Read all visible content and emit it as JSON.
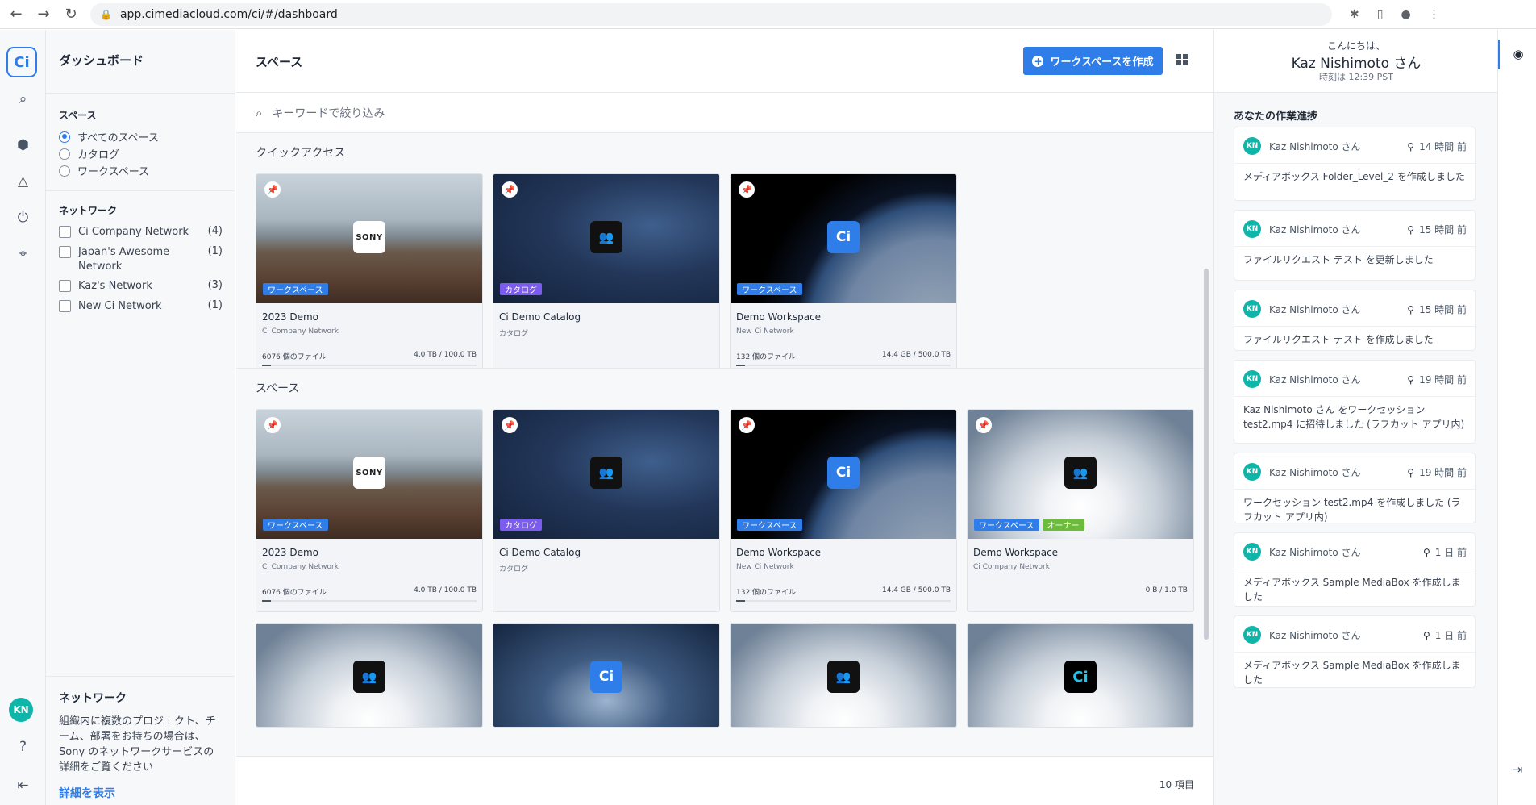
{
  "browser": {
    "url": "app.cimediacloud.com/ci/#/dashboard",
    "back": "←",
    "forward": "→",
    "reload": "↻"
  },
  "rail": {
    "logo": "Ci",
    "avatar": "KN",
    "icons": [
      "search-icon",
      "box-icon",
      "cloud-icon",
      "power-icon",
      "settings-icon",
      "help-icon",
      "logout-icon"
    ]
  },
  "sidebar": {
    "title": "ダッシュボード",
    "spaces_heading": "スペース",
    "space_filters": [
      {
        "label": "すべてのスペース",
        "selected": true
      },
      {
        "label": "カタログ",
        "selected": false
      },
      {
        "label": "ワークスペース",
        "selected": false
      }
    ],
    "network_heading": "ネットワーク",
    "networks": [
      {
        "label": "Ci Company Network",
        "count": "(4)"
      },
      {
        "label": "Japan's Awesome Network",
        "count": "(1)"
      },
      {
        "label": "Kaz's Network",
        "count": "(3)"
      },
      {
        "label": "New Ci Network",
        "count": "(1)"
      }
    ],
    "promo": {
      "title": "ネットワーク",
      "text": "組織内に複数のプロジェクト、チーム、部署をお持ちの場合は、Sony のネットワークサービスの詳細をご覧ください",
      "link": "詳細を表示"
    }
  },
  "main": {
    "title": "スペース",
    "create_button": "ワークスペースを作成",
    "search_placeholder": "キーワードで絞り込み",
    "quick_access_title": "クイックアクセス",
    "spaces_title": "スペース",
    "item_count": "10 項目",
    "quick_access": [
      {
        "name": "2023 Demo",
        "network": "Ci Company Network",
        "files": "6076 個のファイル",
        "size": "4.0 TB / 100.0 TB",
        "usage": 0.04,
        "tags": [
          "ワークスペース"
        ],
        "thumb": "beach",
        "icon": "sony-logo",
        "icon_text": "SONY"
      },
      {
        "name": "Ci Demo Catalog",
        "network": "カタログ",
        "files": "",
        "size": "",
        "tags": [
          "カタログ"
        ],
        "thumb": "space",
        "icon": "users-icon",
        "icon_text": "👥"
      },
      {
        "name": "Demo Workspace",
        "network": "New Ci Network",
        "files": "132 個のファイル",
        "size": "14.4 GB / 500.0 TB",
        "usage": 0.0,
        "tags": [
          "ワークスペース"
        ],
        "thumb": "earth",
        "icon": "ci-logo",
        "icon_text": "Ci"
      }
    ],
    "spaces": [
      {
        "name": "2023 Demo",
        "network": "Ci Company Network",
        "files": "6076 個のファイル",
        "size": "4.0 TB / 100.0 TB",
        "usage": 0.04,
        "tags": [
          "ワークスペース"
        ],
        "thumb": "beach",
        "icon": "sony-logo",
        "icon_text": "SONY"
      },
      {
        "name": "Ci Demo Catalog",
        "network": "カタログ",
        "files": "",
        "size": "",
        "tags": [
          "カタログ"
        ],
        "thumb": "space",
        "icon": "users-icon",
        "icon_text": "👥"
      },
      {
        "name": "Demo Workspace",
        "network": "New Ci Network",
        "files": "132 個のファイル",
        "size": "14.4 GB / 500.0 TB",
        "usage": 0.0,
        "tags": [
          "ワークスペース"
        ],
        "thumb": "earth",
        "icon": "ci-logo",
        "icon_text": "Ci"
      },
      {
        "name": "Demo Workspace",
        "network": "Ci Company Network",
        "files": "",
        "size": "0 B / 1.0 TB",
        "tags": [
          "ワークスペース",
          "オーナー"
        ],
        "thumb": "cloud",
        "icon": "users-icon",
        "icon_text": "👥"
      }
    ],
    "partial_row": [
      {
        "thumb": "cloud",
        "icon": "users-icon",
        "icon_text": "👥"
      },
      {
        "thumb": "storm",
        "icon": "ci-logo",
        "icon_text": "Ci"
      },
      {
        "thumb": "cloud",
        "icon": "users-icon",
        "icon_text": "👥"
      },
      {
        "thumb": "cloud",
        "icon": "ci-logo-black",
        "icon_text": "Ci"
      }
    ]
  },
  "activity": {
    "greeting": "こんにちは、",
    "user": "Kaz Nishimoto さん",
    "time": "時刻は 12:39 PST",
    "heading": "あなたの作業進捗",
    "items": [
      {
        "user": "Kaz Nishimoto さん",
        "when": "14 時間 前",
        "message": "メディアボックス Folder_Level_2 を作成しました"
      },
      {
        "user": "Kaz Nishimoto さん",
        "when": "15 時間 前",
        "message": "ファイルリクエスト テスト を更新しました"
      },
      {
        "user": "Kaz Nishimoto さん",
        "when": "15 時間 前",
        "message": "ファイルリクエスト テスト を作成しました"
      },
      {
        "user": "Kaz Nishimoto さん",
        "when": "19 時間 前",
        "message": "Kaz Nishimoto さん をワークセッション test2.mp4 に招待しました (ラフカット アプリ内)"
      },
      {
        "user": "Kaz Nishimoto さん",
        "when": "19 時間 前",
        "message": "ワークセッション test2.mp4 を作成しました (ラフカット アプリ内)"
      },
      {
        "user": "Kaz Nishimoto さん",
        "when": "1 日 前",
        "message": "メディアボックス Sample MediaBox を作成しました"
      },
      {
        "user": "Kaz Nishimoto さん",
        "when": "1 日 前",
        "message": "メディアボックス Sample MediaBox を作成しました"
      }
    ]
  },
  "colors": {
    "accent": "#2e7de9",
    "catalog_tag": "#7c5cf0",
    "owner_tag": "#6dbb3a",
    "avatar": "#10b5a9",
    "pin": "#f08c2a"
  }
}
